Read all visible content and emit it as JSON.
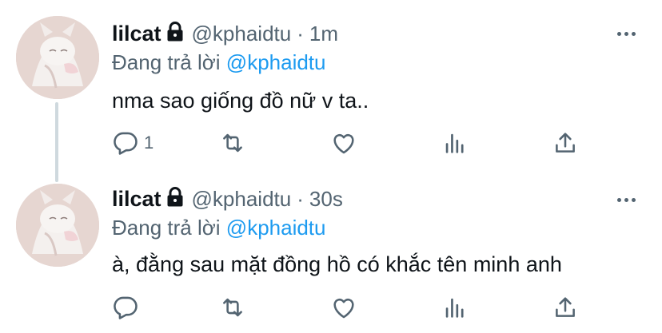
{
  "tweets": [
    {
      "name": "lilcat",
      "handle": "@kphaidtu",
      "separator": "·",
      "time": "1m",
      "replying_prefix": "Đang trả lời",
      "replying_to": "@kphaidtu",
      "text": "nma sao giống đồ nữ v ta..",
      "reply_count": "1"
    },
    {
      "name": "lilcat",
      "handle": "@kphaidtu",
      "separator": "·",
      "time": "30s",
      "replying_prefix": "Đang trả lời",
      "replying_to": "@kphaidtu",
      "text": "à, đằng sau mặt đồng hồ có khắc tên minh anh",
      "reply_count": ""
    }
  ],
  "icons": [
    "lock-icon",
    "more-icon",
    "reply-icon",
    "retweet-icon",
    "like-icon",
    "analytics-icon",
    "share-icon"
  ],
  "colors": {
    "text": "#0f1419",
    "secondary": "#536471",
    "mention": "#1d9bf0",
    "thread_line": "#cfd9de"
  }
}
